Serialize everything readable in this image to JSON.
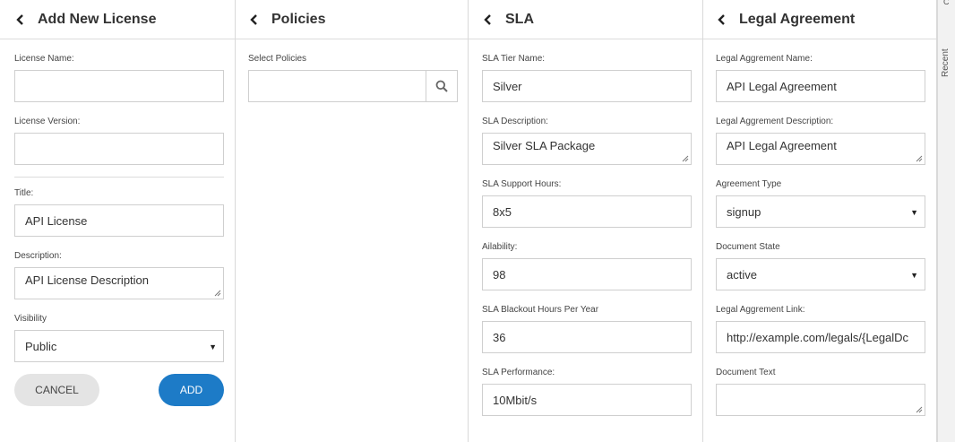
{
  "license": {
    "title": "Add New License",
    "name_label": "License Name:",
    "name_value": "",
    "version_label": "License Version:",
    "version_value": "",
    "title_label": "Title:",
    "title_value": "API License",
    "description_label": "Description:",
    "description_value": "API License Description",
    "visibility_label": "Visibility",
    "visibility_value": "Public",
    "cancel_label": "CANCEL",
    "add_label": "ADD"
  },
  "policies": {
    "title": "Policies",
    "select_label": "Select Policies",
    "search_value": ""
  },
  "sla": {
    "title": "SLA",
    "tier_label": "SLA Tier Name:",
    "tier_value": "Silver",
    "description_label": "SLA Description:",
    "description_value": "Silver SLA Package",
    "support_label": "SLA Support Hours:",
    "support_value": "8x5",
    "availability_label": "Ailability:",
    "availability_value": "98",
    "blackout_label": "SLA Blackout Hours Per Year",
    "blackout_value": "36",
    "performance_label": "SLA Performance:",
    "performance_value": "10Mbit/s"
  },
  "legal": {
    "title": "Legal Agreement",
    "name_label": "Legal Aggrement Name:",
    "name_value": "API Legal Agreement",
    "description_label": "Legal Aggrement Description:",
    "description_value": "API Legal Agreement",
    "type_label": "Agreement Type",
    "type_value": "signup",
    "state_label": "Document State",
    "state_value": "active",
    "link_label": "Legal Aggrement Link:",
    "link_value": "http://example.com/legals/{LegalDc",
    "text_label": "Document Text",
    "text_value": ""
  },
  "side": {
    "recent_label": "Recent",
    "corner_glyph": "C"
  },
  "colors": {
    "accent": "#1d7bc7",
    "cancel_bg": "#e4e4e4",
    "border": "#cfcfcf"
  }
}
